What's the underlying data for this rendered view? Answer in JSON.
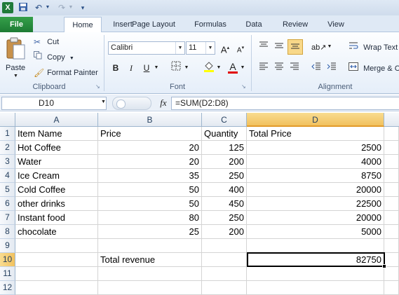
{
  "quick_access": {
    "undo_icon": "undo-icon",
    "redo_icon": "redo-icon",
    "save_icon": "save-icon"
  },
  "tabs": {
    "file": "File",
    "items": [
      "Home",
      "Insert",
      "Page Layout",
      "Formulas",
      "Data",
      "Review",
      "View"
    ]
  },
  "clipboard": {
    "paste": "Paste",
    "cut": "Cut",
    "copy": "Copy",
    "format_painter": "Format Painter",
    "label": "Clipboard"
  },
  "font": {
    "name": "Calibri",
    "size": "11",
    "label": "Font",
    "bold": "B",
    "italic": "I",
    "underline": "U",
    "grow": "A",
    "shrink": "A"
  },
  "alignment": {
    "wrap_text": "Wrap Text",
    "merge": "Merge & C",
    "label": "Alignment"
  },
  "formula_bar": {
    "name_box": "D10",
    "fx": "fx",
    "formula": "=SUM(D2:D8)"
  },
  "columns": [
    "A",
    "B",
    "C",
    "D"
  ],
  "rows": [
    {
      "num": "1",
      "a": "Item Name",
      "b": "Price",
      "c": "Quantity",
      "d": "Total Price"
    },
    {
      "num": "2",
      "a": "Hot Coffee",
      "b": "20",
      "c": "125",
      "d": "2500"
    },
    {
      "num": "3",
      "a": "Water",
      "b": "20",
      "c": "200",
      "d": "4000"
    },
    {
      "num": "4",
      "a": "Ice Cream",
      "b": "35",
      "c": "250",
      "d": "8750"
    },
    {
      "num": "5",
      "a": "Cold Coffee",
      "b": "50",
      "c": "400",
      "d": "20000"
    },
    {
      "num": "6",
      "a": "other drinks",
      "b": "50",
      "c": "450",
      "d": "22500"
    },
    {
      "num": "7",
      "a": "Instant food",
      "b": "80",
      "c": "250",
      "d": "20000"
    },
    {
      "num": "8",
      "a": "chocolate",
      "b": "25",
      "c": "200",
      "d": "5000"
    },
    {
      "num": "9",
      "a": "",
      "b": "",
      "c": "",
      "d": ""
    },
    {
      "num": "10",
      "a": "",
      "b": "Total revenue",
      "c": "",
      "d": "82750"
    },
    {
      "num": "11",
      "a": "",
      "b": "",
      "c": "",
      "d": ""
    },
    {
      "num": "12",
      "a": "",
      "b": "",
      "c": "",
      "d": ""
    }
  ],
  "colors": {
    "file_tab": "#1d7b34",
    "selection_header": "#f1c15e"
  }
}
